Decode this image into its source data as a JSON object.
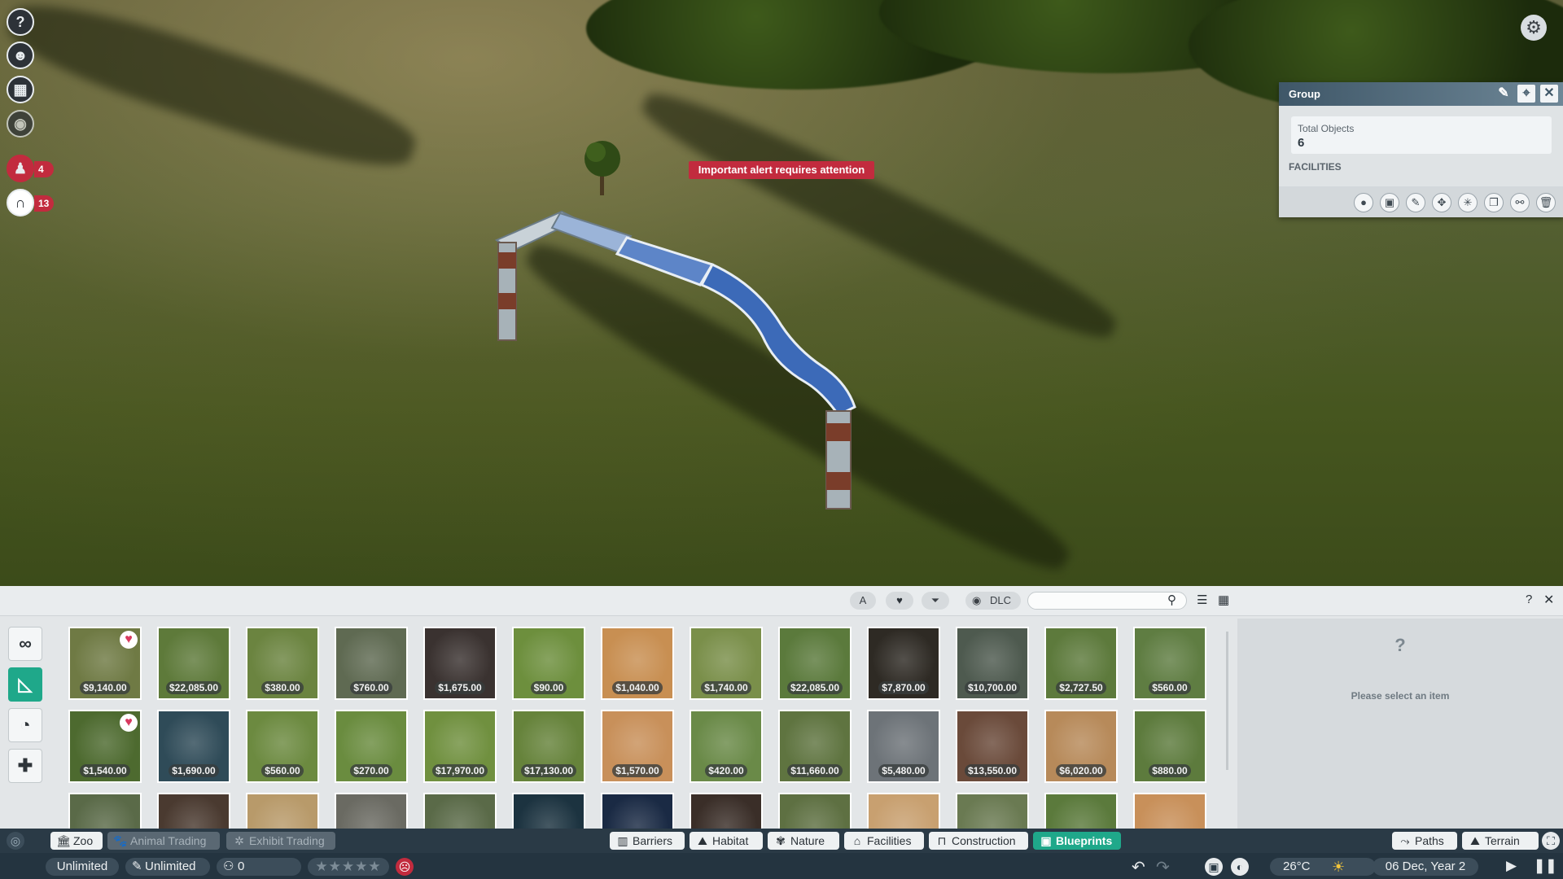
{
  "scene": {
    "alert_text": "Important alert requires attention",
    "left_icons": [
      {
        "name": "help-icon",
        "glyph": "?"
      },
      {
        "name": "zoopedia-icon",
        "glyph": "☻"
      },
      {
        "name": "calendar-icon",
        "glyph": "▦"
      },
      {
        "name": "visibility-icon",
        "glyph": "◉"
      },
      {
        "name": "staff-icon",
        "glyph": "♟",
        "badge": "4"
      },
      {
        "name": "guest-icon",
        "glyph": "∩",
        "badge": "13"
      }
    ],
    "settings_glyph": "⚙"
  },
  "group_panel": {
    "title": "Group",
    "total_objects_label": "Total Objects",
    "total_objects_value": "6",
    "section_label": "FACILITIES",
    "tools": [
      {
        "name": "paint-icon",
        "glyph": "●"
      },
      {
        "name": "blueprint-icon",
        "glyph": "▣"
      },
      {
        "name": "edit-icon",
        "glyph": "✎"
      },
      {
        "name": "move-icon",
        "glyph": "✥"
      },
      {
        "name": "explode-icon",
        "glyph": "✳"
      },
      {
        "name": "duplicate-icon",
        "glyph": "❐"
      },
      {
        "name": "unlink-icon",
        "glyph": "⚯"
      },
      {
        "name": "delete-icon",
        "glyph": "🗑"
      }
    ]
  },
  "browser": {
    "filter_a": "A",
    "dlc_label": "DLC",
    "search_placeholder": "",
    "info_question": "?",
    "info_message": "Please select an item",
    "items_row1": [
      {
        "price": "$9,140.00",
        "fav": true,
        "bg": "#6f7a44"
      },
      {
        "price": "$22,085.00",
        "fav": false,
        "bg": "#5e7a3a"
      },
      {
        "price": "$380.00",
        "fav": false,
        "bg": "#6b8440"
      },
      {
        "price": "$760.00",
        "fav": false,
        "bg": "#5f6a52"
      },
      {
        "price": "$1,675.00",
        "fav": false,
        "bg": "#3a3230"
      },
      {
        "price": "$90.00",
        "fav": false,
        "bg": "#6d8f3d"
      },
      {
        "price": "$1,040.00",
        "fav": false,
        "bg": "#c88f52"
      },
      {
        "price": "$1,740.00",
        "fav": false,
        "bg": "#7a8f4a"
      },
      {
        "price": "$22,085.00",
        "fav": false,
        "bg": "#5b7a3c"
      },
      {
        "price": "$7,870.00",
        "fav": false,
        "bg": "#2e2a24"
      },
      {
        "price": "$10,700.00",
        "fav": false,
        "bg": "#4e5a4f"
      },
      {
        "price": "$2,727.50",
        "fav": false,
        "bg": "#5d7a3c"
      },
      {
        "price": "$560.00",
        "fav": false,
        "bg": "#5f7d42"
      }
    ],
    "items_row2": [
      {
        "price": "$1,540.00",
        "fav": true,
        "bg": "#4d6a2f"
      },
      {
        "price": "$1,690.00",
        "fav": false,
        "bg": "#2f4b58"
      },
      {
        "price": "$560.00",
        "fav": false,
        "bg": "#6c8a40"
      },
      {
        "price": "$270.00",
        "fav": false,
        "bg": "#6a8c3f"
      },
      {
        "price": "$17,970.00",
        "fav": false,
        "bg": "#70903f"
      },
      {
        "price": "$17,130.00",
        "fav": false,
        "bg": "#66833b"
      },
      {
        "price": "$1,570.00",
        "fav": false,
        "bg": "#c8905a"
      },
      {
        "price": "$420.00",
        "fav": false,
        "bg": "#6a8a48"
      },
      {
        "price": "$11,660.00",
        "fav": false,
        "bg": "#5f7440"
      },
      {
        "price": "$5,480.00",
        "fav": false,
        "bg": "#6d7378"
      },
      {
        "price": "$13,550.00",
        "fav": false,
        "bg": "#6a4a3a"
      },
      {
        "price": "$6,020.00",
        "fav": false,
        "bg": "#b78a5a"
      },
      {
        "price": "$880.00",
        "fav": false,
        "bg": "#5d7b3d"
      }
    ],
    "items_row3": [
      {
        "bg": "#5a6a48"
      },
      {
        "bg": "#4a3a30"
      },
      {
        "bg": "#b89a6a"
      },
      {
        "bg": "#6a6a62"
      },
      {
        "bg": "#5a6a48"
      },
      {
        "bg": "#1c3340"
      },
      {
        "bg": "#1a2a44"
      },
      {
        "bg": "#3a2e28"
      },
      {
        "bg": "#5e7042"
      },
      {
        "bg": "#c8a070"
      },
      {
        "bg": "#6a7a52"
      },
      {
        "bg": "#5b7a3c"
      },
      {
        "bg": "#c8905a"
      }
    ]
  },
  "categories": {
    "left": [
      {
        "name": "tab-zoo",
        "label": "Zoo",
        "glyph": "🏛",
        "state": "normal"
      },
      {
        "name": "tab-animal-trading",
        "label": "Animal Trading",
        "glyph": "🐾",
        "state": "dim"
      },
      {
        "name": "tab-exhibit-trading",
        "label": "Exhibit Trading",
        "glyph": "✲",
        "state": "dim"
      }
    ],
    "center": [
      {
        "name": "tab-barriers",
        "label": "Barriers",
        "glyph": "▥",
        "state": "normal"
      },
      {
        "name": "tab-habitat",
        "label": "Habitat",
        "glyph": "⛰",
        "state": "normal"
      },
      {
        "name": "tab-nature",
        "label": "Nature",
        "glyph": "✾",
        "state": "normal"
      },
      {
        "name": "tab-facilities",
        "label": "Facilities",
        "glyph": "⌂",
        "state": "normal"
      },
      {
        "name": "tab-construction",
        "label": "Construction",
        "glyph": "⊓",
        "state": "normal"
      },
      {
        "name": "tab-blueprints",
        "label": "Blueprints",
        "glyph": "▣",
        "state": "on"
      }
    ],
    "right": [
      {
        "name": "tab-paths",
        "label": "Paths",
        "glyph": "⤳",
        "state": "normal"
      },
      {
        "name": "tab-terrain",
        "label": "Terrain",
        "glyph": "⛰",
        "state": "normal"
      }
    ]
  },
  "status": {
    "money": "Unlimited",
    "research": "Unlimited",
    "guests": "0",
    "stars": "★★★★★",
    "temperature": "26°C",
    "date": "06 Dec, Year 2"
  },
  "colors": {
    "accent": "#1fa88a",
    "alert": "#c22b3e",
    "panel_header": "#3f5768"
  }
}
